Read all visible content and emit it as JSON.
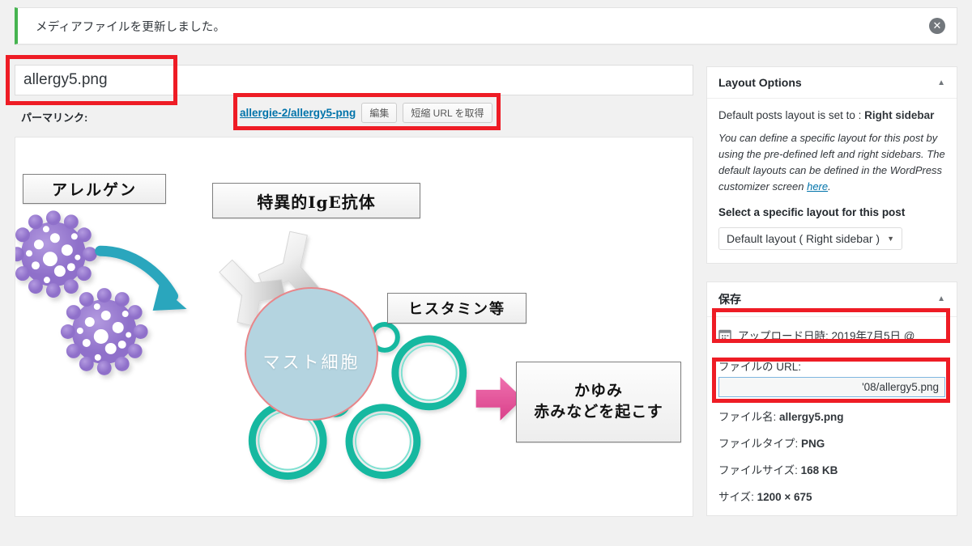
{
  "notice": {
    "message": "メディアファイルを更新しました。",
    "dismiss_icon": "close-circle-icon",
    "dismiss_glyph": "✕",
    "accent_color": "#46b450"
  },
  "editor": {
    "title_value": "allergy5.png",
    "title_placeholder": "タイトルを追加",
    "permalink_label": "パーマリンク:",
    "permalink_url": "allergie-2/allergy5-png",
    "edit_button": "編集",
    "shortlink_button": "短縮 URL を取得"
  },
  "image": {
    "alt": "アレルギー反応の仕組み図",
    "labels": {
      "allergen": "アレルゲン",
      "ige": "特異的IgE抗体",
      "mast_cell": "マスト細胞",
      "histamine": "ヒスタミン等",
      "result_line1": "かゆみ",
      "result_line2": "赤みなどを起こす"
    },
    "colors": {
      "allergen": "#9b7fd4",
      "arrow_blue": "#2ba6bd",
      "arrow_pink": "#e8559c",
      "mast_fill": "#b4d4e0",
      "mast_border": "#e8868a",
      "granule": "#14b8a0"
    }
  },
  "sidebar": {
    "layout_panel": {
      "title": "Layout Options",
      "toggle_icon": "chevron-up-icon",
      "default_prefix": "Default posts layout is set to : ",
      "default_value": "Right sidebar",
      "description_1": "You can define a specific layout for this post by using the pre-defined left and right sidebars. The default layouts can be defined in the WordPress customizer screen ",
      "description_link": "here",
      "description_2": ".",
      "select_label": "Select a specific layout for this post",
      "select_value": "Default layout ( Right sidebar )",
      "select_caret": "▼"
    },
    "save_panel": {
      "title": "保存",
      "toggle_icon": "chevron-up-icon",
      "calendar_icon": "calendar-icon",
      "upload_date": "アップロード日時: 2019年7月5日 @",
      "file_url_label": "ファイルの URL:",
      "file_url_value": "'08/allergy5.png",
      "rows": [
        {
          "label": "ファイル名:",
          "value": "allergy5.png"
        },
        {
          "label": "ファイルタイプ:",
          "value": "PNG"
        },
        {
          "label": "ファイルサイズ:",
          "value": "168 KB"
        },
        {
          "label": "サイズ:",
          "value": "1200 × 675"
        }
      ]
    }
  },
  "highlights": {
    "color": "#ee1c25"
  }
}
